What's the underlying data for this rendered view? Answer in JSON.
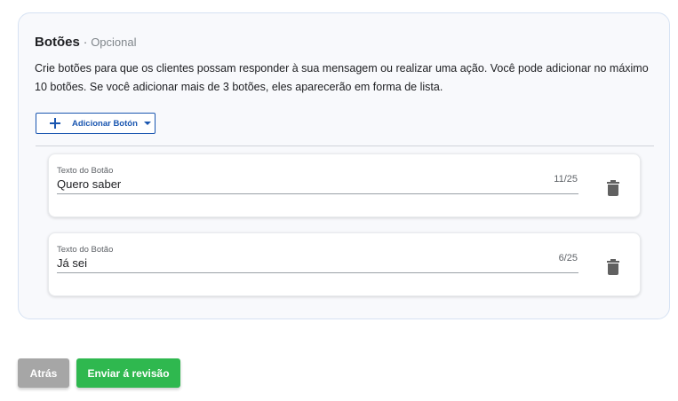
{
  "section": {
    "title": "Botões",
    "separator": "·",
    "optional_label": "Opcional",
    "description": "Crie botões para que os clientes possam responder à sua mensagem ou realizar uma ação. Você pode adicionar no máximo 10 botões. Se você adicionar mais de 3 botões, eles aparecerão em forma de lista."
  },
  "add_button": {
    "label": "Adicionar Botón",
    "icon": "plus-icon",
    "dropdown_icon": "caret-down-icon"
  },
  "buttons": [
    {
      "field_label": "Texto do Botão",
      "value": "Quero saber",
      "counter": "11/25",
      "delete_icon": "trash-icon"
    },
    {
      "field_label": "Texto do Botão",
      "value": "Já sei",
      "counter": "6/25",
      "delete_icon": "trash-icon"
    }
  ],
  "footer": {
    "back_label": "Atrás",
    "submit_label": "Enviar á revisão"
  },
  "colors": {
    "primary_blue": "#1a56b0",
    "submit_green": "#2fb84f",
    "back_gray": "#a6a6a6",
    "card_bg": "#f8f9fc",
    "card_border": "#d6e2f3"
  }
}
